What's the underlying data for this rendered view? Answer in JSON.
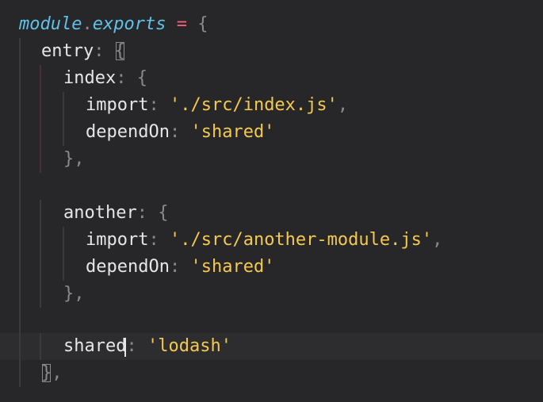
{
  "editor": {
    "lines": {
      "l1": {
        "a": "module",
        "b": ".",
        "c": "exports",
        "d": " = ",
        "e": "{"
      },
      "l2": {
        "a": "entry",
        "b": ": ",
        "c": "{"
      },
      "l3": {
        "a": "index",
        "b": ": ",
        "c": "{"
      },
      "l4": {
        "a": "import",
        "b": ": ",
        "c": "'./src/index.js'",
        "d": ","
      },
      "l5": {
        "a": "dependOn",
        "b": ": ",
        "c": "'shared'"
      },
      "l6": {
        "a": "},"
      },
      "l8": {
        "a": "another",
        "b": ": ",
        "c": "{"
      },
      "l9": {
        "a": "import",
        "b": ": ",
        "c": "'./src/another-module.js'",
        "d": ","
      },
      "l10": {
        "a": "dependOn",
        "b": ": ",
        "c": "'shared'"
      },
      "l11": {
        "a": "},"
      },
      "l13": {
        "a": "shared",
        "b": ": ",
        "c": "'lodash'"
      },
      "l14": {
        "a": "}",
        "b": ","
      }
    },
    "colors": {
      "background": "#272729",
      "keyword": "#5fc2e8",
      "operator": "#f0607a",
      "string": "#f5c94e",
      "property": "#e6e6e6",
      "punctuation": "#8a8a8c"
    }
  }
}
